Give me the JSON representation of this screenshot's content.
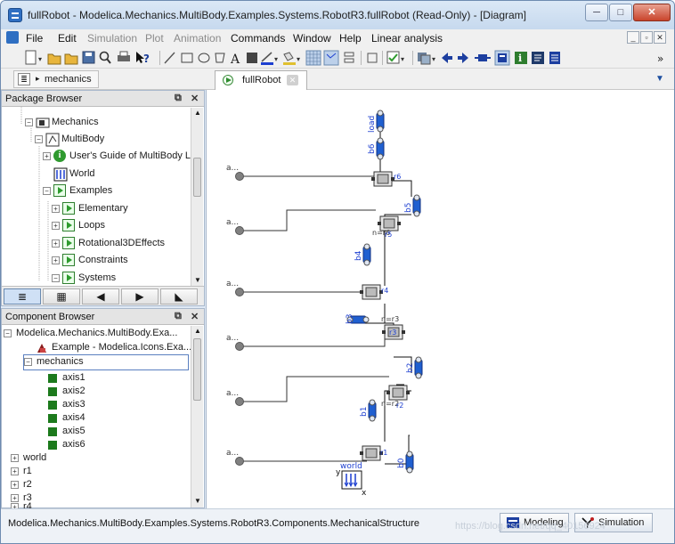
{
  "window": {
    "title": "fullRobot - Modelica.Mechanics.MultiBody.Examples.Systems.RobotR3.fullRobot  (Read-Only) - [Diagram]",
    "minimize": "─",
    "maximize": "□",
    "close": "✕"
  },
  "menu": {
    "items": [
      "File",
      "Edit",
      "Simulation",
      "Plot",
      "Animation",
      "Commands",
      "Window",
      "Help",
      "Linear analysis"
    ],
    "disabled": [
      "Simulation",
      "Plot",
      "Animation"
    ],
    "mdi": [
      "_",
      "▫",
      "✕"
    ]
  },
  "tabs": {
    "breadcrumb": "mechanics",
    "document_tab": "fullRobot"
  },
  "package_browser": {
    "title": "Package Browser",
    "items": [
      {
        "label": "Mechanics",
        "level": 1
      },
      {
        "label": "MultiBody",
        "level": 2
      },
      {
        "label": "User's Guide of MultiBody Li...",
        "level": 3
      },
      {
        "label": "World",
        "level": 3
      },
      {
        "label": "Examples",
        "level": 3
      },
      {
        "label": "Elementary",
        "level": 4
      },
      {
        "label": "Loops",
        "level": 4
      },
      {
        "label": "Rotational3DEffects",
        "level": 4
      },
      {
        "label": "Constraints",
        "level": 4
      },
      {
        "label": "Systems",
        "level": 4
      }
    ],
    "nav_buttons": [
      "≣",
      "▦",
      "◀",
      "▶",
      "◣"
    ]
  },
  "component_browser": {
    "title": "Component Browser",
    "root": "Modelica.Mechanics.MultiBody.Exa...",
    "extends": "Example - Modelica.Icons.Exa...",
    "selected": "mechanics",
    "axes": [
      "axis1",
      "axis2",
      "axis3",
      "axis4",
      "axis5",
      "axis6"
    ],
    "others": [
      "world",
      "r1",
      "r2",
      "r3",
      "r4"
    ]
  },
  "diagram": {
    "inputs": [
      "a...",
      "a...",
      "a...",
      "a...",
      "a...",
      "a..."
    ],
    "labels": {
      "load": "load",
      "b6": "b6",
      "r6": "r6",
      "b5": "b5",
      "r5": "r5",
      "b4": "b4",
      "r4": "r4",
      "b3": "b3",
      "r3": "r3",
      "b2": "b2",
      "r2": "r2",
      "b1": "b1",
      "r1": "r1",
      "b0": "b0",
      "world": "world",
      "n_r6": "n=r6",
      "n_r3": "n=r3",
      "n_r2": "n=r2",
      "axis_x": "x",
      "axis_y": "y"
    }
  },
  "status": {
    "path": "Modelica.Mechanics.MultiBody.Examples.Systems.RobotR3.Components.MechanicalStructure",
    "modeling": "Modeling",
    "simulation": "Simulation",
    "watermark": "https://blog.csdn.net/qq_40156924"
  },
  "colors": {
    "accent": "#2f6fc2",
    "body_blue": "#1f5fd0",
    "connector_gray": "#777777",
    "icon_green": "#2e9b2e"
  }
}
